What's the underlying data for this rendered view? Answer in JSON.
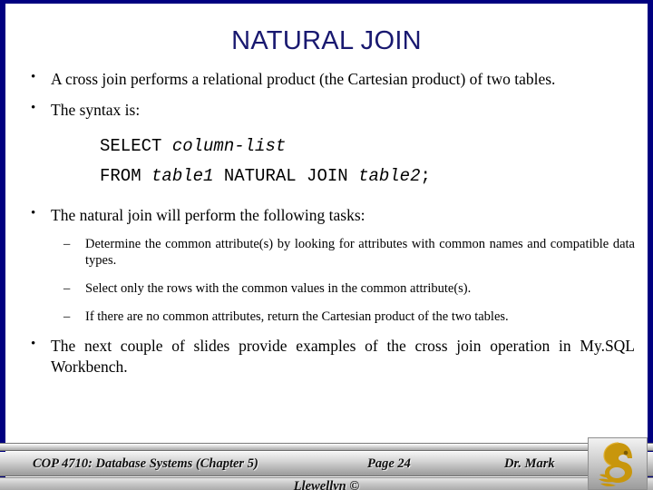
{
  "slide": {
    "title": "NATURAL JOIN",
    "title_color": "#191970",
    "border_color": "#000080",
    "background_color": "#FFFFFF"
  },
  "bullets": [
    {
      "level": 1,
      "text": "A cross join performs a relational product (the Cartesian product) of two tables."
    },
    {
      "level": 1,
      "text": "The syntax is:"
    }
  ],
  "code_block": {
    "line1": {
      "keyword": "SELECT ",
      "identifier": "column-list"
    },
    "line2": {
      "keyword_1": "FROM ",
      "identifier_1": "table1",
      "keyword_2": " NATURAL JOIN ",
      "identifier_2": "table2",
      "terminator": ";"
    }
  },
  "tasks_bullet": {
    "text": "The natural join will perform the following tasks:"
  },
  "sub_bullets": [
    {
      "text": "Determine the common attribute(s) by looking for attributes with common names and compatible data types."
    },
    {
      "text": "Select only the rows with the common values in the common attribute(s)."
    },
    {
      "text": "If there are no common attributes, return the Cartesian product of the two tables."
    }
  ],
  "closing_bullet": {
    "text": "The next couple of slides provide examples of the cross join operation in My.SQL Workbench."
  },
  "footer": {
    "course": "COP 4710: Database Systems  (Chapter 5)",
    "page": "Page 24",
    "author": "Dr. Mark",
    "author_continued": "Llewellyn ©",
    "logo_color": "#C8960C",
    "logo_name": "ucf-pegasus-logo"
  }
}
